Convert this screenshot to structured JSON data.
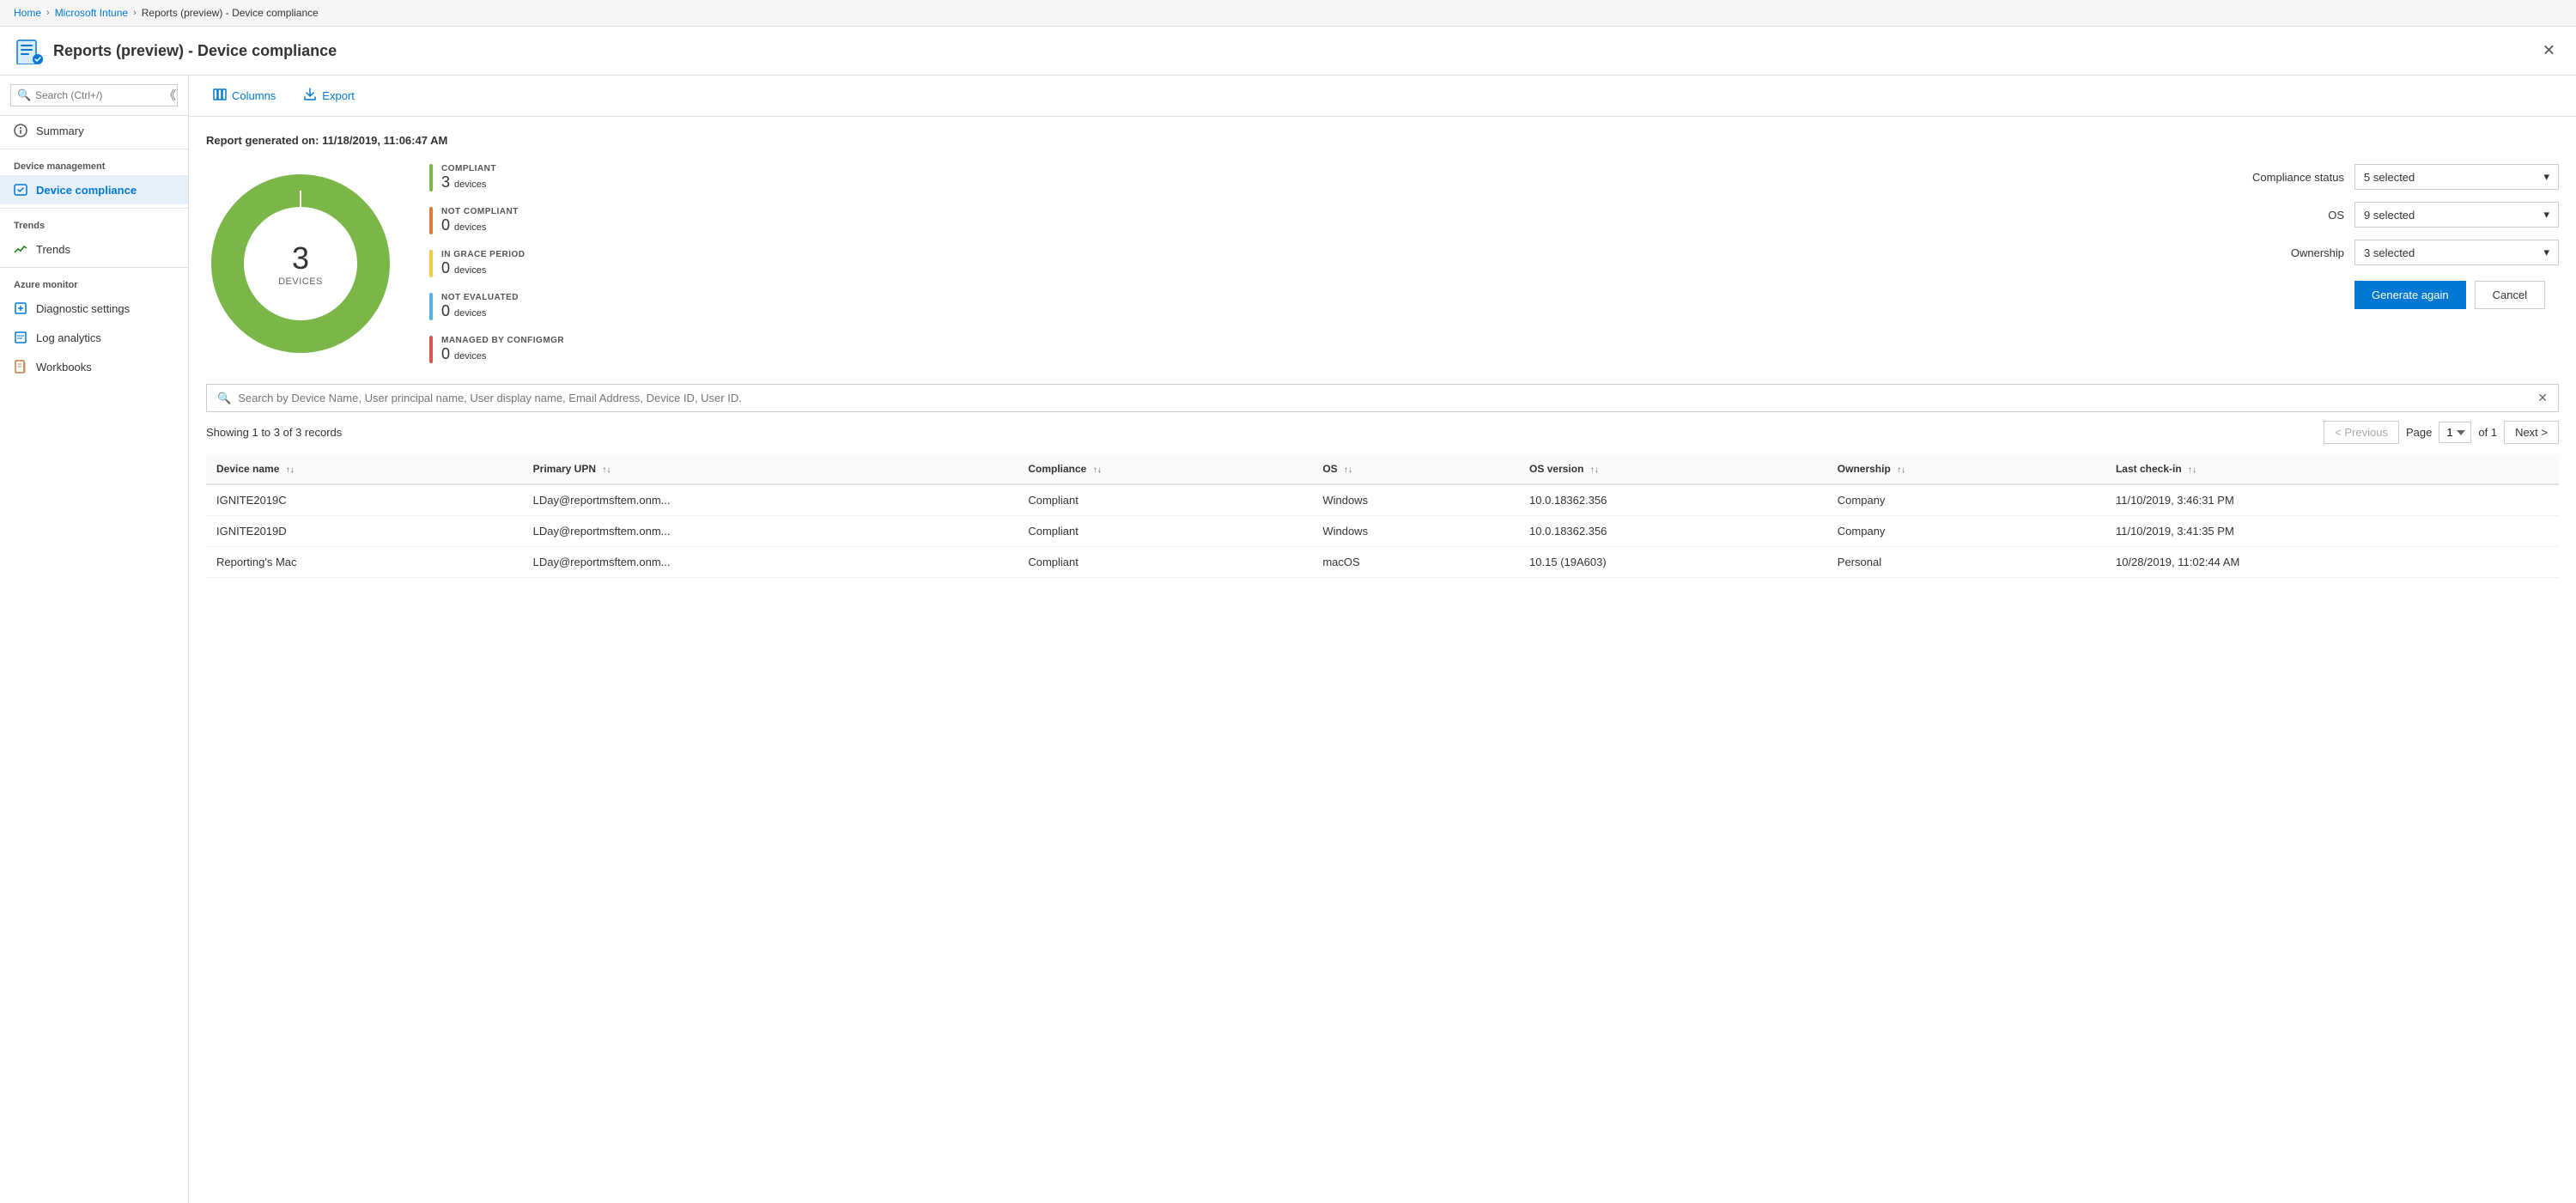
{
  "breadcrumb": {
    "home": "Home",
    "intune": "Microsoft Intune",
    "current": "Reports (preview) - Device compliance"
  },
  "header": {
    "title": "Reports (preview) - Device compliance"
  },
  "sidebar": {
    "search_placeholder": "Search (Ctrl+/)",
    "items": [
      {
        "id": "summary",
        "label": "Summary",
        "icon": "summary",
        "group": null,
        "active": false
      },
      {
        "id": "device-management-group",
        "label": "Device management",
        "group": true
      },
      {
        "id": "device-compliance",
        "label": "Device compliance",
        "icon": "device-compliance",
        "active": true
      },
      {
        "id": "trends-group",
        "label": "Trends",
        "group": true
      },
      {
        "id": "trends",
        "label": "Trends",
        "icon": "trends",
        "active": false
      },
      {
        "id": "azure-monitor-group",
        "label": "Azure monitor",
        "group": true
      },
      {
        "id": "diagnostic-settings",
        "label": "Diagnostic settings",
        "icon": "diagnostic",
        "active": false
      },
      {
        "id": "log-analytics",
        "label": "Log analytics",
        "icon": "log-analytics",
        "active": false
      },
      {
        "id": "workbooks",
        "label": "Workbooks",
        "icon": "workbooks",
        "active": false
      }
    ]
  },
  "toolbar": {
    "columns_label": "Columns",
    "export_label": "Export"
  },
  "report": {
    "generated_label": "Report generated on: 11/18/2019, 11:06:47 AM",
    "donut_center_number": "3",
    "donut_center_label": "DEVICES",
    "legend": [
      {
        "status": "COMPLIANT",
        "count": "3",
        "unit": "devices",
        "color": "#7ab648"
      },
      {
        "status": "NOT COMPLIANT",
        "count": "0",
        "unit": "devices",
        "color": "#e07b39"
      },
      {
        "status": "IN GRACE PERIOD",
        "count": "0",
        "unit": "devices",
        "color": "#f2c94c"
      },
      {
        "status": "NOT EVALUATED",
        "count": "0",
        "unit": "devices",
        "color": "#5ab2e0"
      },
      {
        "status": "MANAGED BY CONFIGMGR",
        "count": "0",
        "unit": "devices",
        "color": "#d9534f"
      }
    ]
  },
  "filters": {
    "compliance_status_label": "Compliance status",
    "compliance_status_value": "5 selected",
    "os_label": "OS",
    "os_value": "9 selected",
    "ownership_label": "Ownership",
    "ownership_value": "3 selected",
    "generate_btn": "Generate again",
    "cancel_btn": "Cancel"
  },
  "search": {
    "placeholder": "Search by Device Name, User principal name, User display name, Email Address, Device ID, User ID."
  },
  "pagination": {
    "showing_text": "Showing 1 to 3 of 3 records",
    "previous_label": "< Previous",
    "next_label": "Next >",
    "page_label": "Page",
    "of_label": "of 1",
    "current_page": "1"
  },
  "table": {
    "columns": [
      {
        "id": "device_name",
        "label": "Device name",
        "sortable": true
      },
      {
        "id": "primary_upn",
        "label": "Primary UPN",
        "sortable": true
      },
      {
        "id": "compliance",
        "label": "Compliance",
        "sortable": true
      },
      {
        "id": "os",
        "label": "OS",
        "sortable": true
      },
      {
        "id": "os_version",
        "label": "OS version",
        "sortable": true
      },
      {
        "id": "ownership",
        "label": "Ownership",
        "sortable": true
      },
      {
        "id": "last_checkin",
        "label": "Last check-in",
        "sortable": true
      }
    ],
    "rows": [
      {
        "device_name": "IGNITE2019C",
        "primary_upn": "LDay@reportmsftem.onm...",
        "compliance": "Compliant",
        "os": "Windows",
        "os_version": "10.0.18362.356",
        "ownership": "Company",
        "last_checkin": "11/10/2019, 3:46:31 PM"
      },
      {
        "device_name": "IGNITE2019D",
        "primary_upn": "LDay@reportmsftem.onm...",
        "compliance": "Compliant",
        "os": "Windows",
        "os_version": "10.0.18362.356",
        "ownership": "Company",
        "last_checkin": "11/10/2019, 3:41:35 PM"
      },
      {
        "device_name": "Reporting's Mac",
        "primary_upn": "LDay@reportmsftem.onm...",
        "compliance": "Compliant",
        "os": "macOS",
        "os_version": "10.15 (19A603)",
        "ownership": "Personal",
        "last_checkin": "10/28/2019, 11:02:44 AM"
      }
    ]
  }
}
